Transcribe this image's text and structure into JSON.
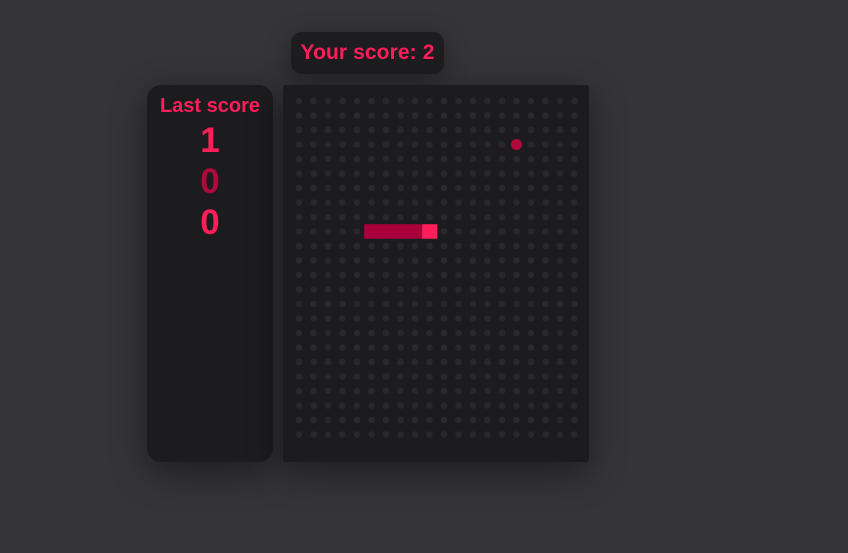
{
  "game": {
    "score_label": "Your score: 2",
    "last_score_title": "Last score",
    "last_scores": [
      {
        "value": "1",
        "color": "#ff1e5a"
      },
      {
        "value": "0",
        "color": "#b00a3c"
      },
      {
        "value": "0",
        "color": "#ff1e5a"
      }
    ],
    "board": {
      "cols": 20,
      "rows": 24,
      "snake_cells": [
        [
          5,
          9
        ],
        [
          6,
          9
        ],
        [
          7,
          9
        ],
        [
          8,
          9
        ],
        [
          9,
          9
        ]
      ],
      "snake_head": [
        9,
        9
      ],
      "food_cell": [
        15,
        3
      ]
    }
  },
  "colors": {
    "background": "#353437",
    "panel": "#1c1b1e",
    "accent": "#ff1e5a",
    "snake_body": "#a9003c",
    "snake_head": "#ff1e5a",
    "food": "#b00a3c",
    "grid_dot": "#29282b"
  }
}
